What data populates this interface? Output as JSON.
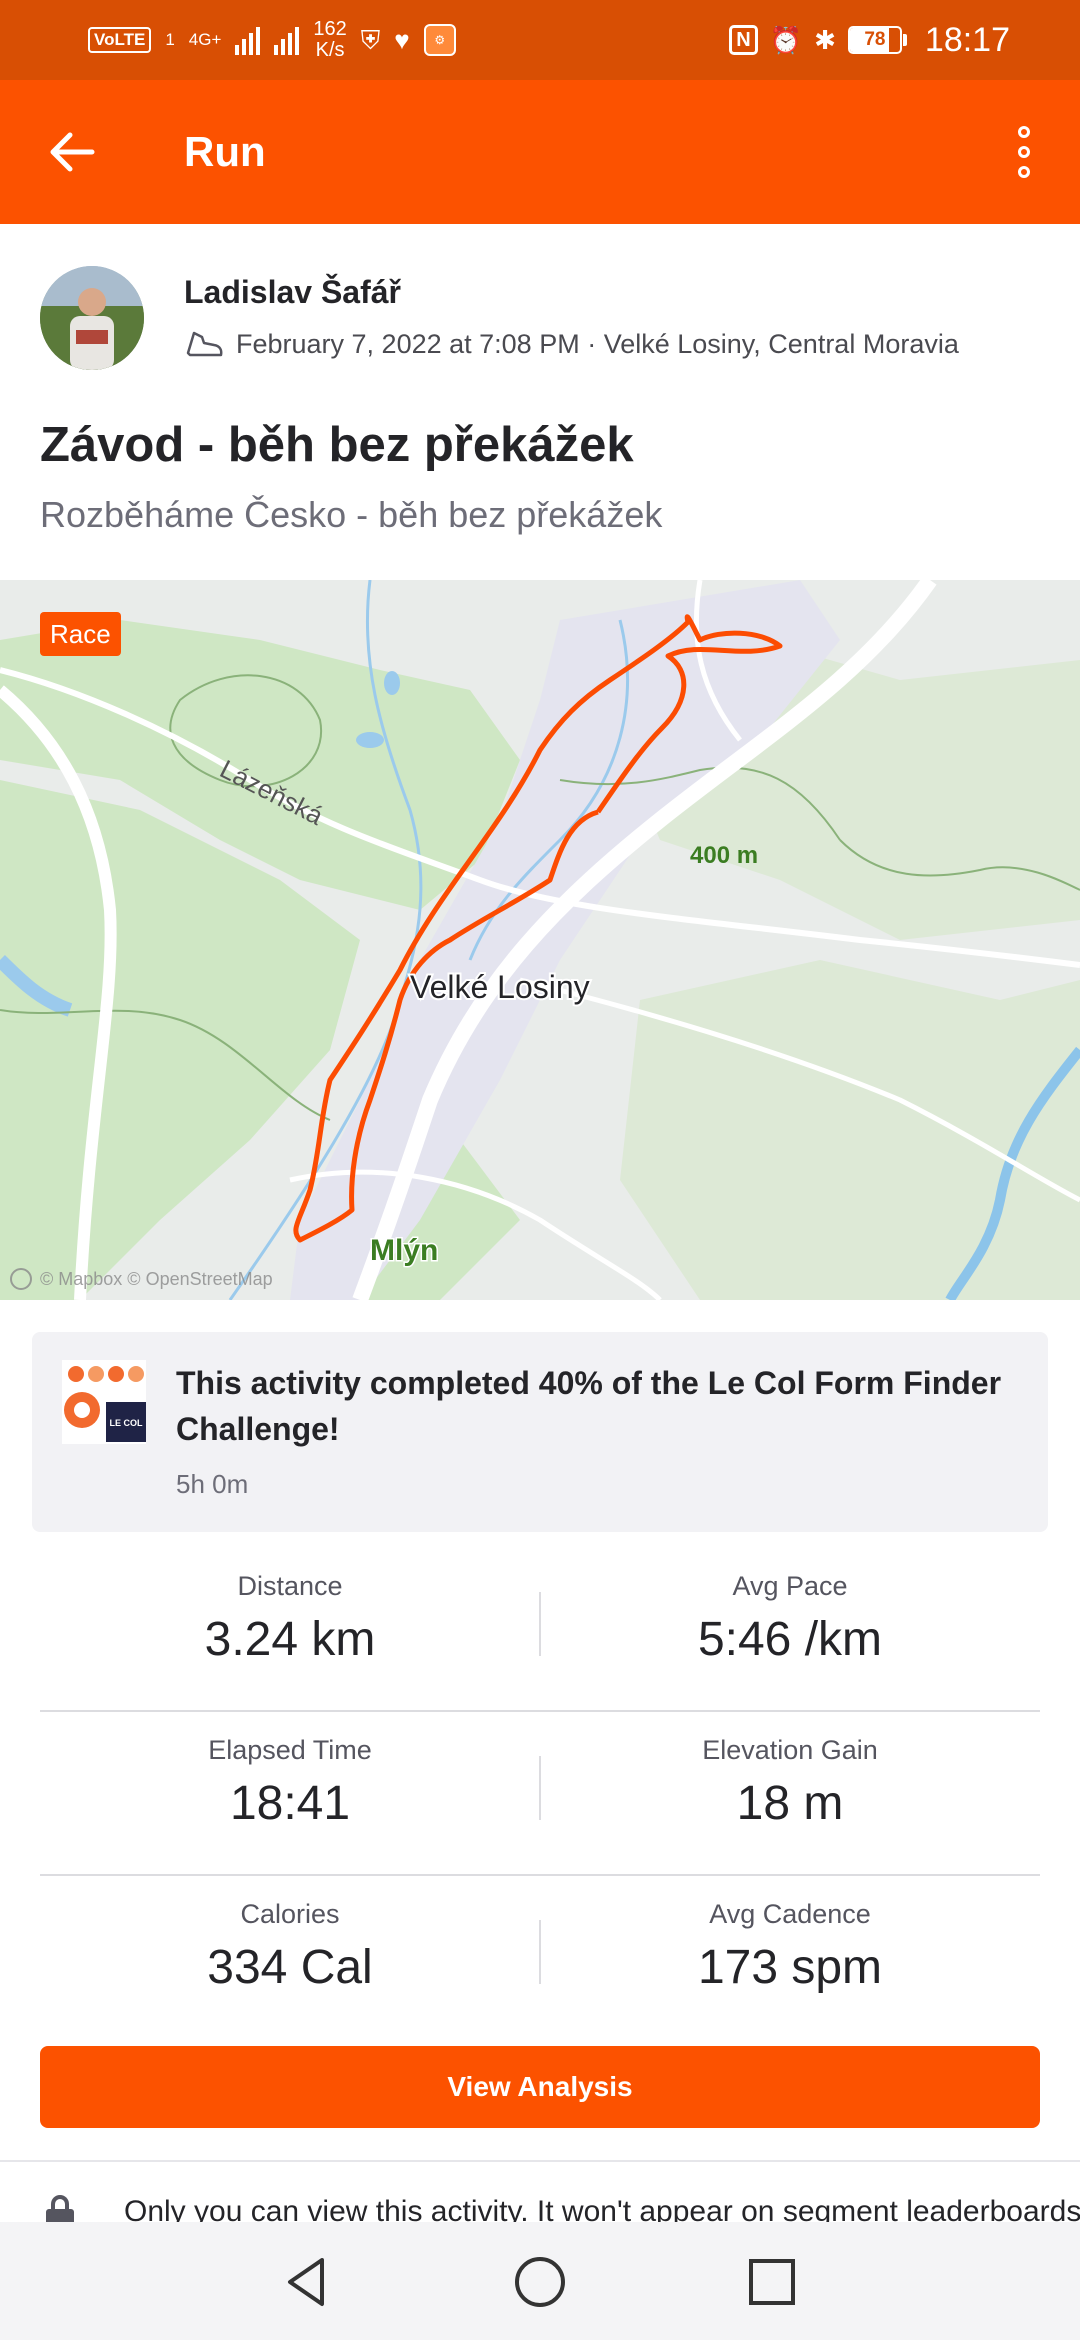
{
  "status_bar": {
    "volte": "VoLTE",
    "sim": "1",
    "network": "4G+",
    "net_speed_value": "162",
    "net_speed_unit": "K/s",
    "battery_level": "78",
    "battery_fraction": 0.78,
    "time": "18:17"
  },
  "app_bar": {
    "title": "Run"
  },
  "activity": {
    "athlete_name": "Ladislav Šafář",
    "date_location": "February 7, 2022 at 7:08 PM · Velké Losiny, Central Moravia",
    "title": "Závod - běh bez překážek",
    "description": "Rozběháme Česko - běh bez překážek"
  },
  "map": {
    "badge": "Race",
    "labels": {
      "street": "Lázeňská",
      "contour": "400 m",
      "town": "Velké Losiny",
      "locality": "Mlýn"
    },
    "attribution": "© Mapbox © OpenStreetMap",
    "route_color": "#fc4c02"
  },
  "challenge": {
    "text": "This activity completed 40% of the Le Col Form Finder Challenge!",
    "time": "5h 0m",
    "logo_text": "LE COL"
  },
  "stats": [
    {
      "left_label": "Distance",
      "left_value": "3.24 km",
      "right_label": "Avg Pace",
      "right_value": "5:46 /km"
    },
    {
      "left_label": "Elapsed Time",
      "left_value": "18:41",
      "right_label": "Elevation Gain",
      "right_value": "18 m"
    },
    {
      "left_label": "Calories",
      "left_value": "334 Cal",
      "right_label": "Avg Cadence",
      "right_value": "173 spm"
    }
  ],
  "cta": {
    "label": "View Analysis"
  },
  "privacy_note": "Only you can view this activity. It won't appear on segment leaderboards",
  "colors": {
    "brand": "#fc5200",
    "status_bar": "#d84f04"
  }
}
